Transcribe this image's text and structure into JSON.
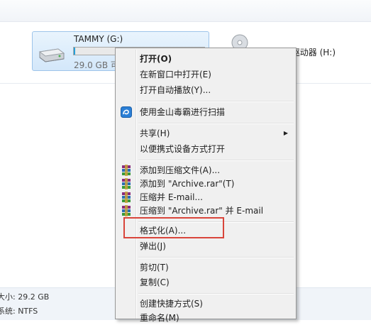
{
  "drive_g": {
    "name": "TAMMY (G:)",
    "free_text": "29.0 GB 可",
    "used_fraction": 0.01
  },
  "drive_h": {
    "label": "DD-ROM 驱动器 (H:)"
  },
  "details": {
    "line1": "大小: 29.2 GB",
    "line2": "系统: NTFS"
  },
  "context_menu": {
    "open": "打开(O)",
    "open_new_window": "在新窗口中打开(E)",
    "open_autoplay": "打开自动播放(Y)...",
    "scan_kingsoft": "使用金山毒霸进行扫描",
    "share": "共享(H)",
    "open_portable": "以便携式设备方式打开",
    "add_to_archive": "添加到压缩文件(A)...",
    "add_to_rar": "添加到 \"Archive.rar\"(T)",
    "compress_email": "压缩并 E-mail...",
    "compress_rar_email": "压缩到 \"Archive.rar\" 并 E-mail",
    "format": "格式化(A)...",
    "eject": "弹出(J)",
    "cut": "剪切(T)",
    "copy": "复制(C)",
    "create_shortcut": "创建快捷方式(S)",
    "rename": "重命名(M)"
  },
  "colors": {
    "highlight_box": "#d9453b",
    "selection_blue": "#26a0da"
  }
}
